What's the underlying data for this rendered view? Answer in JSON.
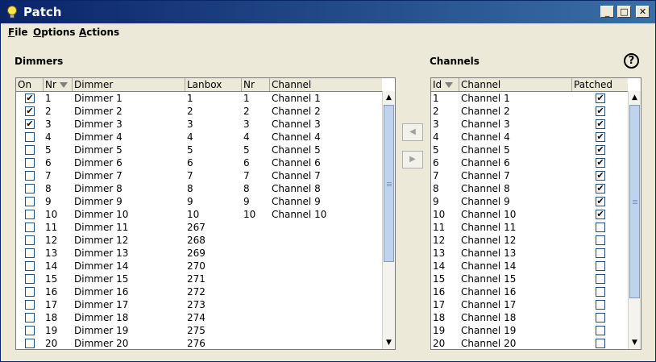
{
  "window": {
    "title": "Patch"
  },
  "menu": [
    {
      "mnemonic": "F",
      "rest": "ile"
    },
    {
      "mnemonic": "O",
      "rest": "ptions"
    },
    {
      "mnemonic": "A",
      "rest": "ctions"
    }
  ],
  "dimmers": {
    "label": "Dimmers",
    "columns": [
      "On",
      "Nr",
      "Dimmer",
      "Lanbox",
      "Nr",
      "Channel"
    ],
    "rows": [
      {
        "on": true,
        "nr": "1",
        "dimmer": "Dimmer 1",
        "lanbox": "1",
        "nr2": "1",
        "channel": "Channel 1"
      },
      {
        "on": true,
        "nr": "2",
        "dimmer": "Dimmer 2",
        "lanbox": "2",
        "nr2": "2",
        "channel": "Channel 2"
      },
      {
        "on": true,
        "nr": "3",
        "dimmer": "Dimmer 3",
        "lanbox": "3",
        "nr2": "3",
        "channel": "Channel 3"
      },
      {
        "on": false,
        "nr": "4",
        "dimmer": "Dimmer 4",
        "lanbox": "4",
        "nr2": "4",
        "channel": "Channel 4"
      },
      {
        "on": false,
        "nr": "5",
        "dimmer": "Dimmer 5",
        "lanbox": "5",
        "nr2": "5",
        "channel": "Channel 5"
      },
      {
        "on": false,
        "nr": "6",
        "dimmer": "Dimmer 6",
        "lanbox": "6",
        "nr2": "6",
        "channel": "Channel 6"
      },
      {
        "on": false,
        "nr": "7",
        "dimmer": "Dimmer 7",
        "lanbox": "7",
        "nr2": "7",
        "channel": "Channel 7"
      },
      {
        "on": false,
        "nr": "8",
        "dimmer": "Dimmer 8",
        "lanbox": "8",
        "nr2": "8",
        "channel": "Channel 8"
      },
      {
        "on": false,
        "nr": "9",
        "dimmer": "Dimmer 9",
        "lanbox": "9",
        "nr2": "9",
        "channel": "Channel 9"
      },
      {
        "on": false,
        "nr": "10",
        "dimmer": "Dimmer 10",
        "lanbox": "10",
        "nr2": "10",
        "channel": "Channel 10"
      },
      {
        "on": false,
        "nr": "11",
        "dimmer": "Dimmer 11",
        "lanbox": "267",
        "nr2": "",
        "channel": ""
      },
      {
        "on": false,
        "nr": "12",
        "dimmer": "Dimmer 12",
        "lanbox": "268",
        "nr2": "",
        "channel": ""
      },
      {
        "on": false,
        "nr": "13",
        "dimmer": "Dimmer 13",
        "lanbox": "269",
        "nr2": "",
        "channel": ""
      },
      {
        "on": false,
        "nr": "14",
        "dimmer": "Dimmer 14",
        "lanbox": "270",
        "nr2": "",
        "channel": ""
      },
      {
        "on": false,
        "nr": "15",
        "dimmer": "Dimmer 15",
        "lanbox": "271",
        "nr2": "",
        "channel": ""
      },
      {
        "on": false,
        "nr": "16",
        "dimmer": "Dimmer 16",
        "lanbox": "272",
        "nr2": "",
        "channel": ""
      },
      {
        "on": false,
        "nr": "17",
        "dimmer": "Dimmer 17",
        "lanbox": "273",
        "nr2": "",
        "channel": ""
      },
      {
        "on": false,
        "nr": "18",
        "dimmer": "Dimmer 18",
        "lanbox": "274",
        "nr2": "",
        "channel": ""
      },
      {
        "on": false,
        "nr": "19",
        "dimmer": "Dimmer 19",
        "lanbox": "275",
        "nr2": "",
        "channel": ""
      },
      {
        "on": false,
        "nr": "20",
        "dimmer": "Dimmer 20",
        "lanbox": "276",
        "nr2": "",
        "channel": ""
      }
    ]
  },
  "channels": {
    "label": "Channels",
    "columns": [
      "Id",
      "Channel",
      "Patched"
    ],
    "rows": [
      {
        "id": "1",
        "channel": "Channel 1",
        "patched": true
      },
      {
        "id": "2",
        "channel": "Channel 2",
        "patched": true
      },
      {
        "id": "3",
        "channel": "Channel 3",
        "patched": true
      },
      {
        "id": "4",
        "channel": "Channel 4",
        "patched": true
      },
      {
        "id": "5",
        "channel": "Channel 5",
        "patched": true
      },
      {
        "id": "6",
        "channel": "Channel 6",
        "patched": true
      },
      {
        "id": "7",
        "channel": "Channel 7",
        "patched": true
      },
      {
        "id": "8",
        "channel": "Channel 8",
        "patched": true
      },
      {
        "id": "9",
        "channel": "Channel 9",
        "patched": true
      },
      {
        "id": "10",
        "channel": "Channel 10",
        "patched": true
      },
      {
        "id": "11",
        "channel": "Channel 11",
        "patched": false
      },
      {
        "id": "12",
        "channel": "Channel 12",
        "patched": false
      },
      {
        "id": "13",
        "channel": "Channel 13",
        "patched": false
      },
      {
        "id": "14",
        "channel": "Channel 14",
        "patched": false
      },
      {
        "id": "15",
        "channel": "Channel 15",
        "patched": false
      },
      {
        "id": "16",
        "channel": "Channel 16",
        "patched": false
      },
      {
        "id": "17",
        "channel": "Channel 17",
        "patched": false
      },
      {
        "id": "18",
        "channel": "Channel 18",
        "patched": false
      },
      {
        "id": "19",
        "channel": "Channel 19",
        "patched": false
      },
      {
        "id": "20",
        "channel": "Channel 20",
        "patched": false
      }
    ]
  },
  "help": {
    "label": "?"
  },
  "check_glyph": "✔",
  "icons": {
    "app": "lightbulb-icon",
    "sort": "sort-descending-icon",
    "move_left": "arrow-left-icon",
    "move_right": "arrow-right-icon"
  }
}
